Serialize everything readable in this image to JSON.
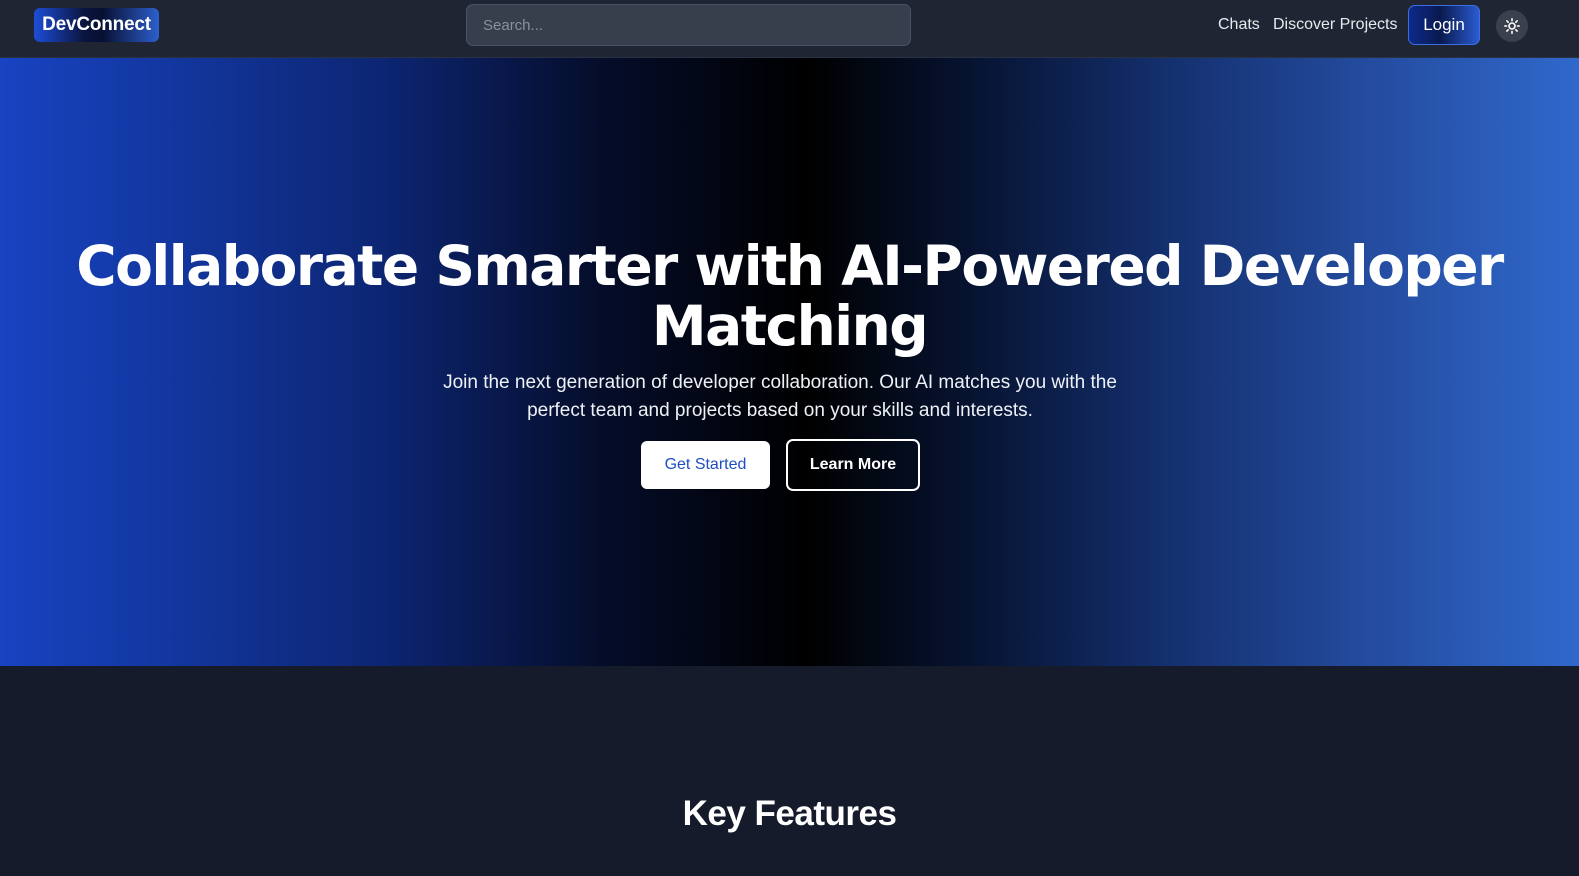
{
  "navbar": {
    "logo": "DevConnect",
    "search_placeholder": "Search...",
    "links": [
      "Chats",
      "Discover Projects"
    ],
    "login_label": "Login",
    "theme_icon": "sun-icon"
  },
  "hero": {
    "title": "Collaborate Smarter with AI-Powered Developer Matching",
    "subtitle": "Join the next generation of developer collaboration. Our AI matches you with the perfect team and projects based on your skills and interests.",
    "primary_button": "Get Started",
    "secondary_button": "Learn More"
  },
  "features": {
    "title": "Key Features"
  },
  "colors": {
    "brand_blue": "#1d4ed8",
    "navbar_bg": "#1f2532",
    "page_bg": "#161b2b",
    "primary_button_text": "#1e4fc2"
  }
}
